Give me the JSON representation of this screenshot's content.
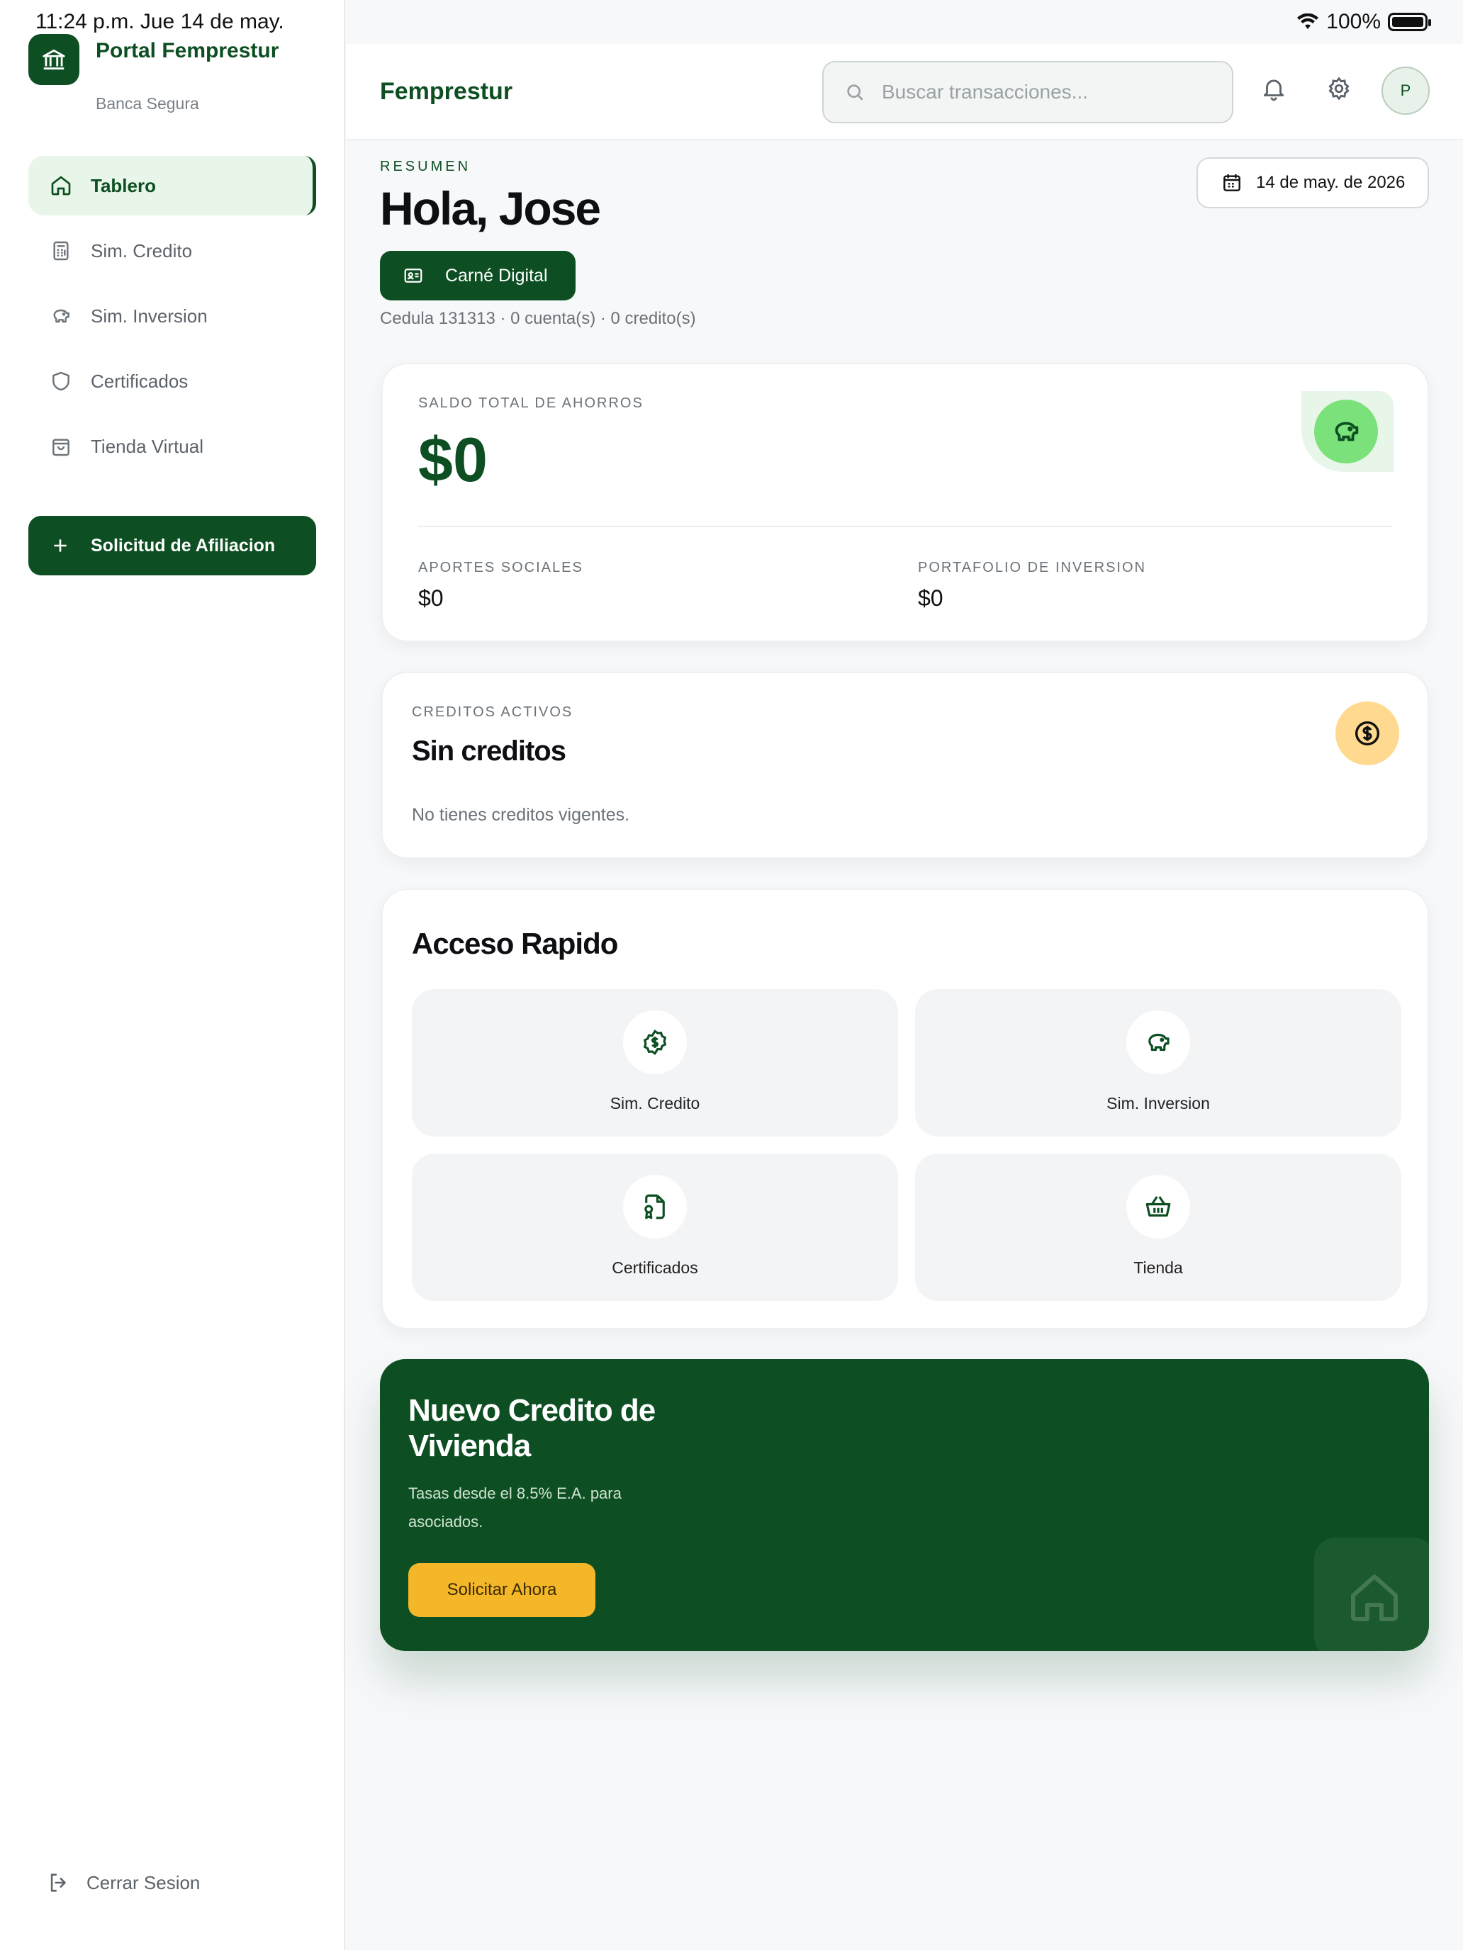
{
  "status": {
    "time": "11:24 p.m.   Jue 14 de may.",
    "battery": "100%"
  },
  "sidebar": {
    "brand_title": "Portal Femprestur",
    "brand_sub": "Banca Segura",
    "items": [
      {
        "label": "Tablero",
        "icon": "home-icon"
      },
      {
        "label": "Sim. Credito",
        "icon": "calculator-icon"
      },
      {
        "label": "Sim. Inversion",
        "icon": "piggy-bank-icon"
      },
      {
        "label": "Certificados",
        "icon": "shield-icon"
      },
      {
        "label": "Tienda Virtual",
        "icon": "shopping-bag-icon"
      }
    ],
    "affiliation_button": "Solicitud de Afiliacion",
    "logout": "Cerrar Sesion"
  },
  "topbar": {
    "title": "Femprestur",
    "search_placeholder": "Buscar transacciones...",
    "avatar_initial": "P"
  },
  "summary": {
    "eyebrow": "RESUMEN",
    "greeting": "Hola, Jose",
    "date": "14 de may. de 2026",
    "carne_button": "Carné Digital",
    "cedula_line": "Cedula 131313 · 0 cuenta(s) · 0 credito(s)"
  },
  "balance": {
    "label": "SALDO TOTAL DE AHORROS",
    "value": "$0",
    "aportes_label": "APORTES SOCIALES",
    "aportes_value": "$0",
    "portafolio_label": "PORTAFOLIO DE INVERSION",
    "portafolio_value": "$0"
  },
  "credits": {
    "label": "CREDITOS ACTIVOS",
    "title": "Sin creditos",
    "description": "No tienes creditos vigentes."
  },
  "quick_access": {
    "title": "Acceso Rapido",
    "tiles": [
      {
        "label": "Sim. Credito",
        "icon": "dollar-badge-icon"
      },
      {
        "label": "Sim. Inversion",
        "icon": "piggy-bank-icon"
      },
      {
        "label": "Certificados",
        "icon": "certificate-file-icon"
      },
      {
        "label": "Tienda",
        "icon": "basket-icon"
      }
    ]
  },
  "promo": {
    "title": "Nuevo Credito de Vivienda",
    "description": "Tasas desde el 8.5% E.A. para asociados.",
    "button": "Solicitar Ahora"
  },
  "colors": {
    "brand": "#0d4f22",
    "accent_yellow": "#f5b72a",
    "mint": "#7be27b",
    "coin": "#ffd98f"
  }
}
